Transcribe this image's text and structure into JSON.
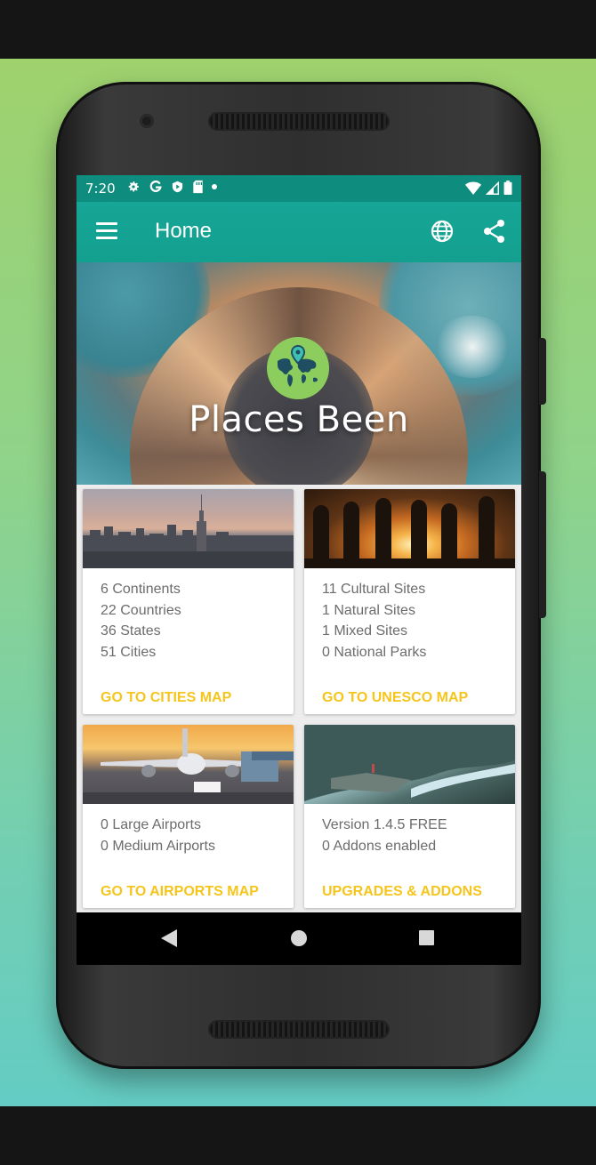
{
  "status_bar": {
    "time": "7:20",
    "icons": [
      "settings-icon",
      "google-icon",
      "play-icon",
      "sd-card-icon",
      "dot-icon"
    ],
    "right_icons": [
      "wifi-icon",
      "signal-icon",
      "battery-icon"
    ]
  },
  "app_bar": {
    "title": "Home",
    "menu_icon": "menu-icon",
    "actions": [
      "globe-icon",
      "share-icon"
    ]
  },
  "hero": {
    "app_name": "Places Been",
    "logo_icon": "world-map-pin-icon"
  },
  "cards": [
    {
      "image": "city-skyline-photo",
      "lines": [
        "6 Continents",
        "22 Countries",
        "36 States",
        "51 Cities"
      ],
      "action": "GO TO CITIES MAP"
    },
    {
      "image": "moai-statues-photo",
      "lines": [
        "11 Cultural Sites",
        "1 Natural Sites",
        "1 Mixed Sites",
        "0 National Parks"
      ],
      "action": "GO TO UNESCO MAP"
    },
    {
      "image": "airport-airplane-photo",
      "lines": [
        "0 Large Airports",
        "0 Medium Airports"
      ],
      "action": "GO TO AIRPORTS MAP"
    },
    {
      "image": "mountain-lake-photo",
      "lines": [
        "Version 1.4.5 FREE",
        "0 Addons enabled"
      ],
      "action": "UPGRADES & ADDONS"
    }
  ],
  "nav_bar": {
    "buttons": [
      "back-icon",
      "home-icon",
      "recents-icon"
    ]
  },
  "colors": {
    "primary": "#13a08f",
    "status_bar": "#0e8c7d",
    "accent": "#f5c51c",
    "logo_green": "#8ccd5e"
  }
}
